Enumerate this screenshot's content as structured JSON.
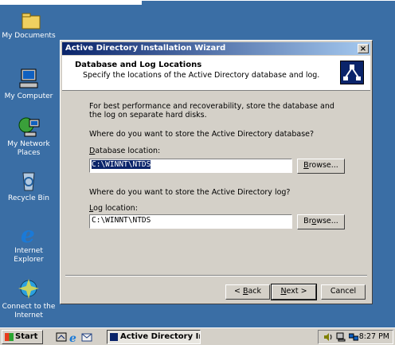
{
  "desktop": {
    "icons": [
      {
        "label": "",
        "icon": "folder-icon"
      },
      {
        "label": "My Documents",
        "icon": "my-documents-icon"
      },
      {
        "label": "My Computer",
        "icon": "my-computer-icon"
      },
      {
        "label": "My Network Places",
        "icon": "network-places-icon"
      },
      {
        "label": "Recycle Bin",
        "icon": "recycle-bin-icon"
      },
      {
        "label": "Internet Explorer",
        "icon": "internet-explorer-icon"
      },
      {
        "label": "Connect to the Internet",
        "icon": "connect-internet-icon"
      }
    ]
  },
  "dialog": {
    "title": "Active Directory Installation Wizard",
    "close_label": "×",
    "header_title": "Database and Log Locations",
    "header_subtitle": "Specify the locations of the Active Directory database and log.",
    "intro": "For best performance and recoverability, store the database and the log on separate hard disks.",
    "db_question": "Where do you want to store the Active Directory database?",
    "db_label_accel": "D",
    "db_label_rest": "atabase location:",
    "db_value": "C:\\WINNT\\NTDS",
    "browse1_pre": "",
    "browse1_accel": "B",
    "browse1_rest": "rowse...",
    "log_question": "Where do you want to store the Active Directory log?",
    "log_label_accel": "L",
    "log_label_rest": "og location:",
    "log_value": "C:\\WINNT\\NTDS",
    "browse2_pre": "Br",
    "browse2_accel": "o",
    "browse2_rest": "wse...",
    "back_pre": "< ",
    "back_accel": "B",
    "back_rest": "ack",
    "next_accel": "N",
    "next_rest": "ext >",
    "cancel_label": "Cancel"
  },
  "taskbar": {
    "start_label": "Start",
    "task_label": "Active Directory Installat...",
    "clock": "8:27 PM"
  },
  "colors": {
    "desktop": "#3a6ea5",
    "title_start": "#0a246a",
    "title_end": "#a6caf0",
    "face": "#d4d0c8"
  }
}
